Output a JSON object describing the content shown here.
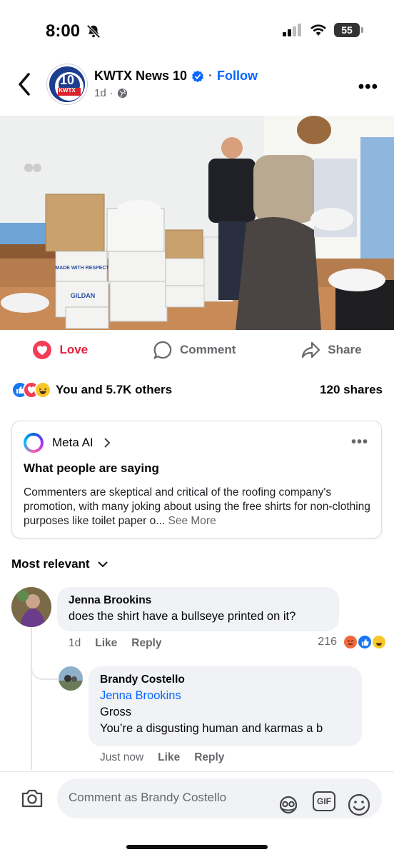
{
  "status_bar": {
    "time": "8:00",
    "battery": "55"
  },
  "post": {
    "page_name": "KWTX News 10",
    "follow_label": "Follow",
    "timestamp": "1d",
    "logo_text": "10",
    "logo_sub": "KWTX",
    "photo_box_label_1": "MADE WITH RESPECT",
    "photo_box_label_2": "GILDAN"
  },
  "actions": {
    "love": "Love",
    "comment": "Comment",
    "share": "Share"
  },
  "reactions": {
    "summary": "You and 5.7K others",
    "shares": "120 shares"
  },
  "meta_ai": {
    "label": "Meta AI",
    "title": "What people are saying",
    "body": "Commenters are skeptical and critical of the roofing company's promotion, with many joking about using the free shirts for non-clothing purposes like toilet paper o...",
    "see_more": "See More"
  },
  "sort_label": "Most relevant",
  "comments": [
    {
      "author": "Jenna Brookins",
      "text": "does the shirt have a bullseye printed on it?",
      "time": "1d",
      "like": "Like",
      "reply": "Reply",
      "reaction_count": "216"
    },
    {
      "author": "Brandy Costello",
      "mention": "Jenna Brookins",
      "line1": "Gross",
      "line2": "You’re a disgusting human and karmas a b",
      "time": "Just now",
      "like": "Like",
      "reply": "Reply"
    }
  ],
  "composer": {
    "placeholder": "Comment as Brandy Costello",
    "gif": "GIF"
  },
  "colors": {
    "accent": "#0866ff",
    "love": "#e41e3f",
    "muted": "#65676b"
  }
}
